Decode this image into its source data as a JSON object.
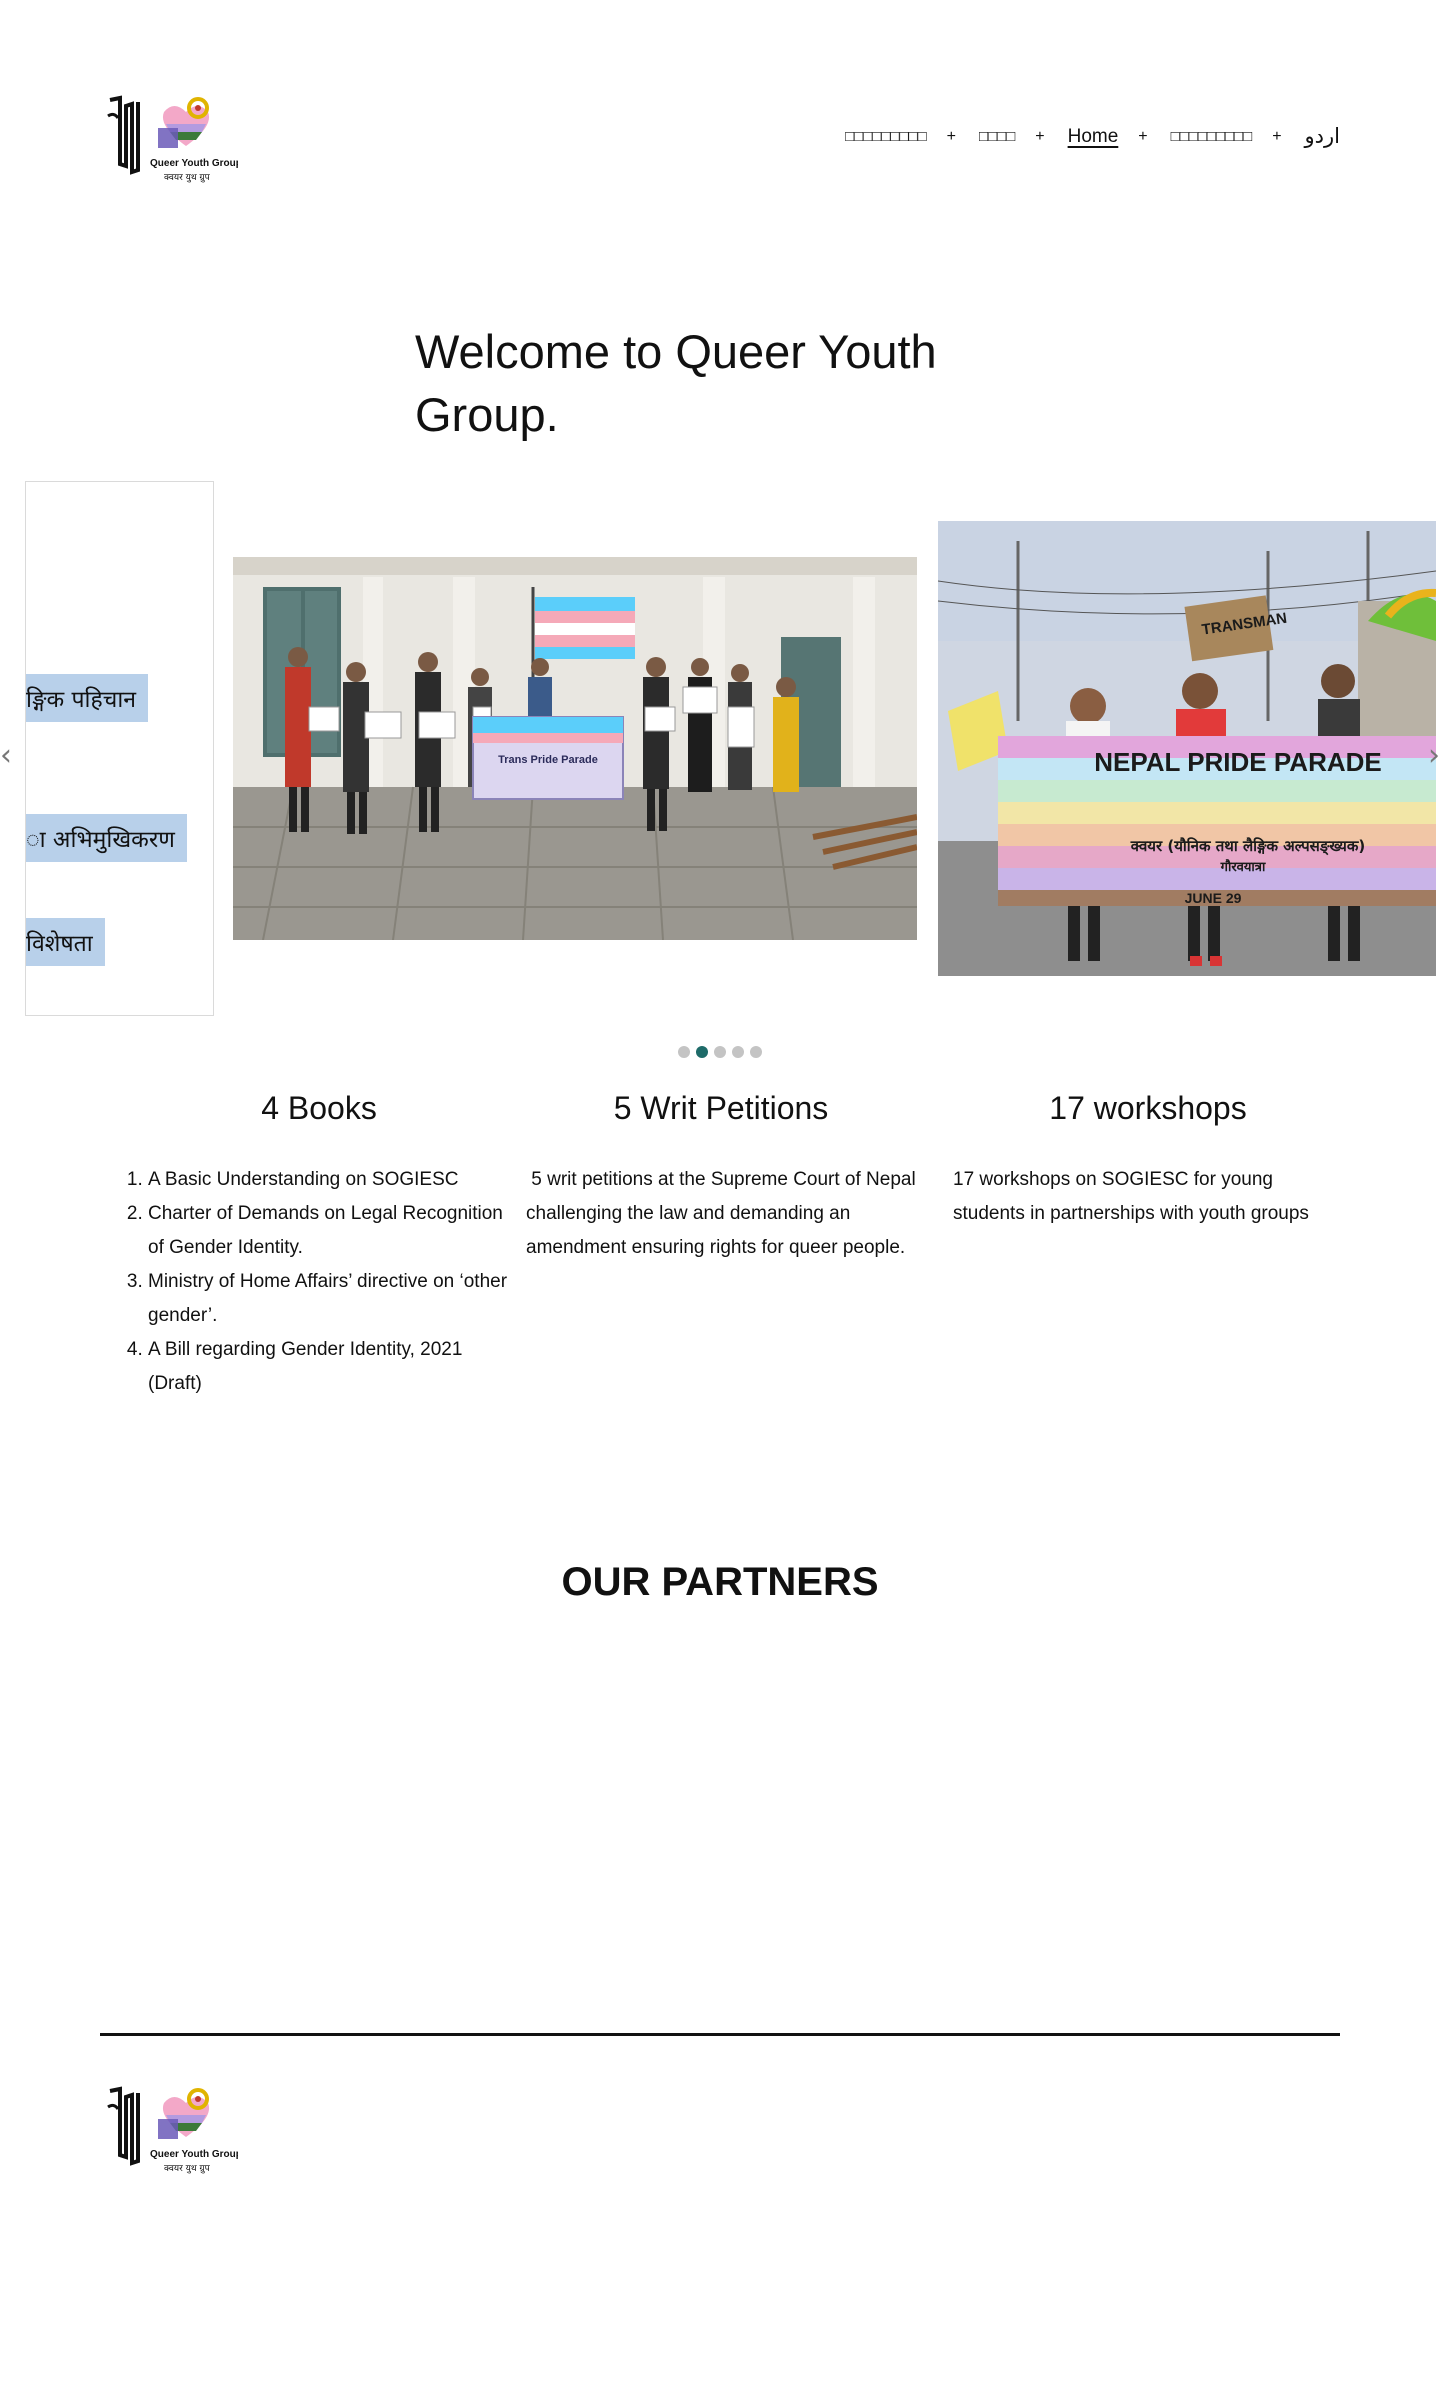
{
  "site": {
    "logo_text": "Queer Youth Group",
    "logo_subtext": "क्वयर युथ ग्रुप"
  },
  "nav": {
    "items": [
      {
        "label": "□□□□□□□□□",
        "has_submenu": true
      },
      {
        "label": "□□□□",
        "has_submenu": true
      },
      {
        "label": "Home",
        "has_submenu": true,
        "current": true
      },
      {
        "label": "□□□□□□□□□",
        "has_submenu": true
      },
      {
        "label": "اردو",
        "has_submenu": false
      }
    ],
    "submenu_toggle": "+"
  },
  "welcome": {
    "title": "Welcome to Queer Youth Group."
  },
  "carousel": {
    "card_labels": [
      "ङ्गिक पहिचान",
      "ा अभिमुखिकरण",
      "विशेषता"
    ],
    "slide2": {
      "banner_text": "Trans Pride Parade"
    },
    "slide3": {
      "banner_title": "NEPAL PRIDE PARADE",
      "banner_line2": "क्वयर (यौनिक तथा लैङ्गिक अल्पसङ्ख्यक)",
      "banner_line3": "गौरवयात्रा",
      "banner_date": "JUNE 29",
      "placard_text": "TRANSMAN"
    },
    "prev_icon": "chevron-left-icon",
    "next_icon": "chevron-right-icon",
    "prev_glyph": "‹",
    "next_glyph": "›",
    "slide_count": 5,
    "active_index": 1,
    "active_dot_color": "#1e6b69"
  },
  "stats": [
    {
      "title": "4 Books",
      "items": [
        "A Basic Understanding on SOGIESC",
        "Charter of Demands on Legal Recognition of Gender Identity.",
        "Ministry of Home Affairs’ directive on ‘other gender’.",
        "A Bill regarding Gender Identity, 2021 (Draft)"
      ]
    },
    {
      "title": "5 Writ Petitions",
      "text": " 5 writ petitions at the Supreme Court of Nepal challenging the law and demanding an amendment ensuring rights for queer people."
    },
    {
      "title": "17 workshops",
      "text": "17 workshops on SOGIESC for young students in partnerships with youth groups"
    }
  ],
  "partners": {
    "title": "OUR PARTNERS"
  }
}
